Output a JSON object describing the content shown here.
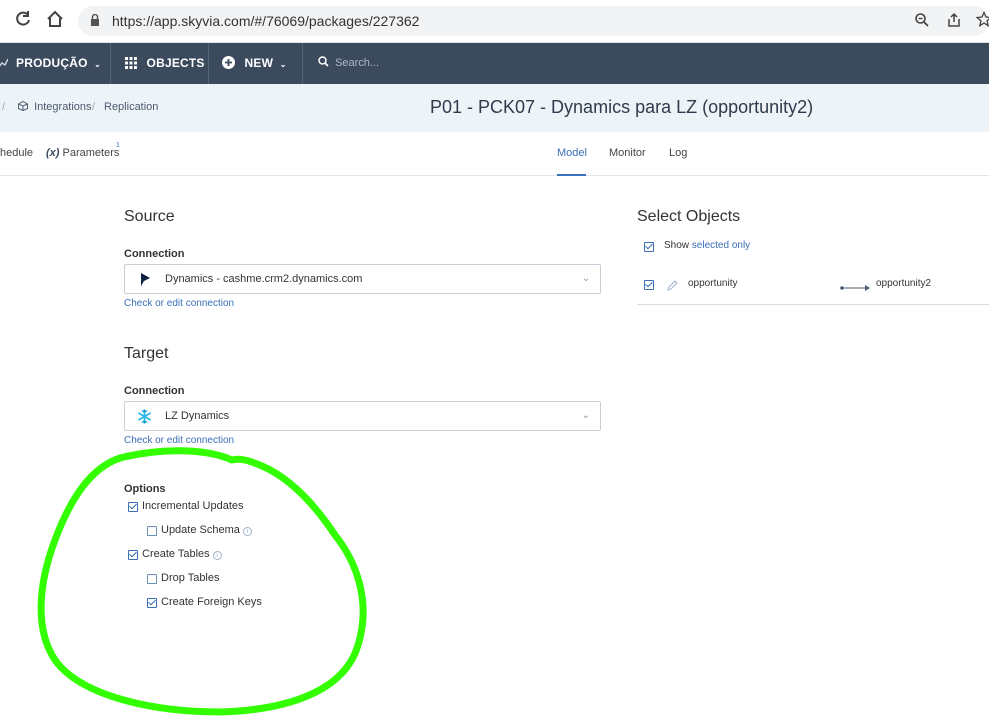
{
  "browser": {
    "url": "https://app.skyvia.com/#/76069/packages/227362"
  },
  "nav": {
    "workspace_label": "PRODUÇÃO",
    "objects_label": "OBJECTS",
    "new_label": "NEW",
    "search_placeholder": "Search..."
  },
  "breadcrumb": {
    "integrations": "Integrations",
    "replication": "Replication"
  },
  "page_title": "P01 - PCK07 - Dynamics para LZ (opportunity2)",
  "subtabs": {
    "schedule_partial": "hedule",
    "parameters_prefix": "(x)",
    "parameters_label": "Parameters",
    "parameters_badge": "1",
    "model": "Model",
    "monitor": "Monitor",
    "log": "Log"
  },
  "source": {
    "title": "Source",
    "connection_label": "Connection",
    "connection_value": "Dynamics - cashme.crm2.dynamics.com",
    "check_link_prefix": "Check or edit ",
    "check_link_suffix": "connection"
  },
  "target": {
    "title": "Target",
    "connection_label": "Connection",
    "connection_value": "LZ Dynamics",
    "check_link_prefix": "Check or edit ",
    "check_link_suffix": "connection"
  },
  "options": {
    "title": "Options",
    "incremental_updates": "Incremental Updates",
    "update_schema": "Update Schema",
    "create_tables": "Create Tables",
    "drop_tables": "Drop Tables",
    "create_foreign_keys": "Create Foreign Keys"
  },
  "select_objects": {
    "title": "Select Objects",
    "show_prefix": "Show ",
    "show_link": "selected only",
    "source_object": "opportunity",
    "target_object": "opportunity2"
  },
  "colors": {
    "nav_bg": "#3c4a5e",
    "accent": "#3b6fb6",
    "highlight_circle": "#33ff00"
  }
}
